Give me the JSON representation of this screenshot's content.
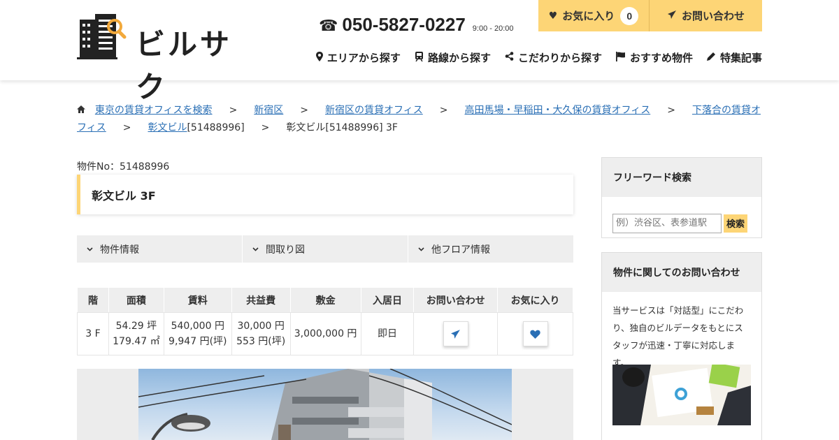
{
  "header": {
    "logo_text": "ビルサク",
    "phone": "050-5827-0227",
    "hours": "9:00 - 20:00",
    "favorite_label": "お気に入り",
    "favorite_count": "0",
    "inquiry_label": "お問い合わせ",
    "nav": [
      {
        "label": "エリアから探す",
        "icon": "map-pin-icon"
      },
      {
        "label": "路線から探す",
        "icon": "train-icon"
      },
      {
        "label": "こだわりから探す",
        "icon": "share-icon"
      },
      {
        "label": "おすすめ物件",
        "icon": "flag-icon"
      },
      {
        "label": "特集記事",
        "icon": "pencil-icon"
      }
    ]
  },
  "breadcrumb": {
    "items": [
      "東京の賃貸オフィスを検索",
      "新宿区",
      "新宿区の賃貸オフィス",
      "高田馬場・早稲田・大久保の賃貸オフィス",
      "下落合の賃貸オフィス",
      "彰文ビル"
    ],
    "item6_suffix": "[51488996]",
    "current": "彰文ビル[51488996] 3F",
    "separator": ">"
  },
  "property": {
    "number_label": "物件No：51488996",
    "title": "彰文ビル 3F"
  },
  "tabs": [
    "物件情報",
    "間取り図",
    "他フロア情報"
  ],
  "table": {
    "headers": [
      "階",
      "面積",
      "賃料",
      "共益費",
      "敷金",
      "入居日",
      "お問い合わせ",
      "お気に入り"
    ],
    "row": {
      "floor": "3 F",
      "area_tsubo": "54.29 坪",
      "area_m2": "179.47 ㎡",
      "rent": "540,000 円",
      "rent_per_tsubo": "9,947 円(坪)",
      "common_fee": "30,000 円",
      "common_per_tsubo": "553 円(坪)",
      "deposit": "3,000,000 円",
      "move_in": "即日"
    }
  },
  "sidebar": {
    "search_title": "フリーワード検索",
    "search_placeholder": "例）渋谷区、表参道駅",
    "search_button": "検索",
    "inquiry_title": "物件に関してのお問い合わせ",
    "inquiry_text": "当サービスは「対話型」にこだわり、独自のビルデータをもとにスタッフが迅速・丁寧に対応します。"
  },
  "colors": {
    "accent": "#fdd576",
    "link": "#2a6fb5",
    "heart": "#2a6fb5"
  }
}
